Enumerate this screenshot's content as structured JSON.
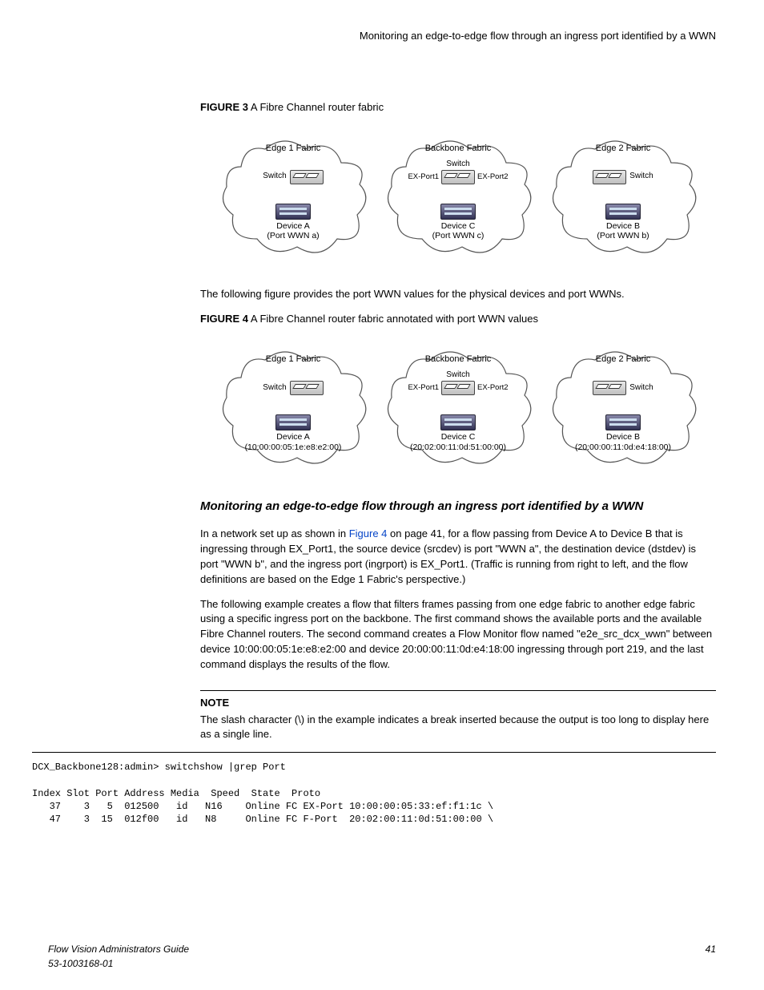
{
  "running_header": "Monitoring an edge-to-edge flow through an ingress port identified by a WWN",
  "fig3": {
    "label": "FIGURE 3",
    "caption": "A Fibre Channel router fabric",
    "left": {
      "title": "Edge 1 Fabric",
      "switch": "Switch",
      "device_name": "Device A",
      "device_sub": "(Port WWN a)"
    },
    "center": {
      "title": "Backbone Fabric",
      "switch": "Switch",
      "p1": "EX-Port1",
      "p2": "EX-Port2",
      "device_name": "Device C",
      "device_sub": "(Port WWN c)"
    },
    "right": {
      "title": "Edge 2 Fabric",
      "switch": "Switch",
      "device_name": "Device B",
      "device_sub": "(Port WWN b)"
    }
  },
  "intertext": "The following figure provides the port WWN values for the physical devices and port WWNs.",
  "fig4": {
    "label": "FIGURE 4",
    "caption": "A Fibre Channel router fabric annotated with port WWN values",
    "left": {
      "title": "Edge 1 Fabric",
      "switch": "Switch",
      "device_name": "Device A",
      "device_sub": "(10:00:00:05:1e:e8:e2:00)"
    },
    "center": {
      "title": "Backbone Fabric",
      "switch": "Switch",
      "p1": "EX-Port1",
      "p2": "EX-Port2",
      "device_name": "Device C",
      "device_sub": "(20:02:00:11:0d:51:00:00)"
    },
    "right": {
      "title": "Edge 2 Fabric",
      "switch": "Switch",
      "device_name": "Device B",
      "device_sub": "(20:00:00:11:0d:e4:18:00)"
    }
  },
  "section_title": "Monitoring an edge-to-edge flow through an ingress port identified by a WWN",
  "para1_a": "In a network set up as shown in ",
  "para1_link": "Figure 4",
  "para1_b": " on page 41, for a flow passing from Device A to Device B that is ingressing through EX_Port1, the source device (srcdev) is port \"WWN a\", the destination device (dstdev) is port \"WWN b\", and the ingress port (ingrport) is EX_Port1. (Traffic is running from right to left, and the flow definitions are based on the Edge 1 Fabric's perspective.)",
  "para2": "The following example creates a flow that filters frames passing from one edge fabric to another edge fabric using a specific ingress port on the backbone. The first command shows the available ports and the available Fibre Channel routers. The second command creates a Flow Monitor flow named \"e2e_src_dcx_wwn\" between device 10:00:00:05:1e:e8:e2:00 and device 20:00:00:11:0d:e4:18:00 ingressing through port 219, and the last command displays the results of the flow.",
  "note": {
    "title": "NOTE",
    "body": "The slash character (\\) in the example indicates a break inserted because the output is too long to display here as a single line."
  },
  "cli": "DCX_Backbone128:admin> switchshow |grep Port\n\nIndex Slot Port Address Media  Speed  State  Proto\n   37    3   5  012500   id   N16    Online FC EX-Port 10:00:00:05:33:ef:f1:1c \\\n   47    3  15  012f00   id   N8     Online FC F-Port  20:02:00:11:0d:51:00:00 \\",
  "footer": {
    "title": "Flow Vision Administrators Guide",
    "doc": "53-1003168-01",
    "page": "41"
  }
}
